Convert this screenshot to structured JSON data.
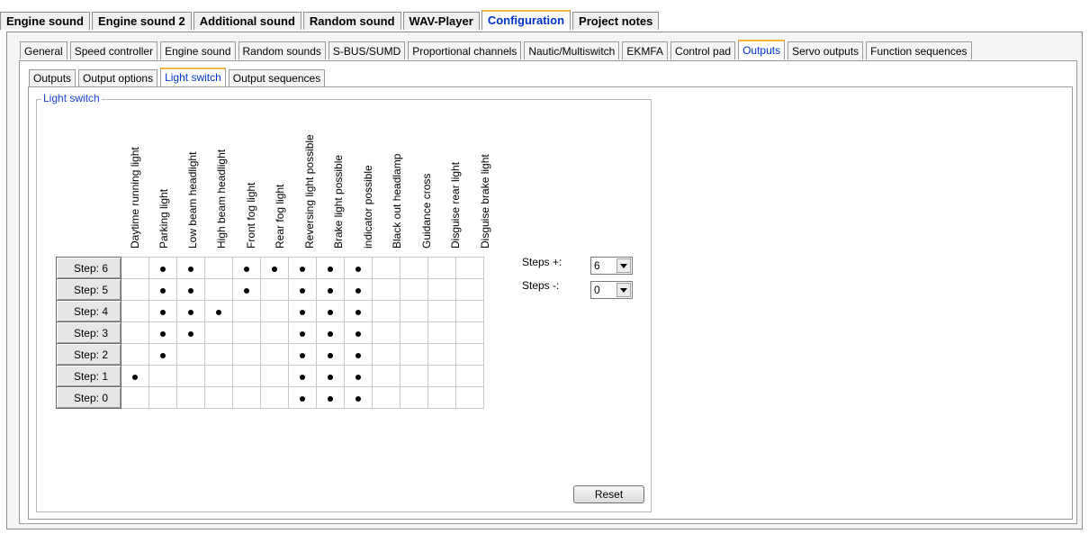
{
  "tabs_level1": [
    "Engine sound",
    "Engine sound 2",
    "Additional sound",
    "Random sound",
    "WAV-Player",
    "Configuration",
    "Project notes"
  ],
  "tabs_level1_active": "Configuration",
  "tabs_level2": [
    "General",
    "Speed controller",
    "Engine sound",
    "Random sounds",
    "S-BUS/SUMD",
    "Proportional channels",
    "Nautic/Multiswitch",
    "EKMFA",
    "Control pad",
    "Outputs",
    "Servo outputs",
    "Function sequences"
  ],
  "tabs_level2_active": "Outputs",
  "tabs_level3": [
    "Outputs",
    "Output options",
    "Light switch",
    "Output sequences"
  ],
  "tabs_level3_active": "Light switch",
  "group_title": "Light switch",
  "columns": [
    "Daytime running light",
    "Parking light",
    "Low beam headlight",
    "High beam headlight",
    "Front fog light",
    "Rear fog light",
    "Reversing light possible",
    "Brake light possible",
    "indicator possible",
    "Black out headlamp",
    "Guidance cross",
    "Disguise rear light",
    "Disguise brake light"
  ],
  "rows": [
    {
      "label": "Step: 6",
      "on": [
        0,
        1,
        1,
        0,
        1,
        1,
        1,
        1,
        1,
        0,
        0,
        0,
        0
      ]
    },
    {
      "label": "Step: 5",
      "on": [
        0,
        1,
        1,
        0,
        1,
        0,
        1,
        1,
        1,
        0,
        0,
        0,
        0
      ]
    },
    {
      "label": "Step: 4",
      "on": [
        0,
        1,
        1,
        1,
        0,
        0,
        1,
        1,
        1,
        0,
        0,
        0,
        0
      ]
    },
    {
      "label": "Step: 3",
      "on": [
        0,
        1,
        1,
        0,
        0,
        0,
        1,
        1,
        1,
        0,
        0,
        0,
        0
      ]
    },
    {
      "label": "Step: 2",
      "on": [
        0,
        1,
        0,
        0,
        0,
        0,
        1,
        1,
        1,
        0,
        0,
        0,
        0
      ]
    },
    {
      "label": "Step: 1",
      "on": [
        1,
        0,
        0,
        0,
        0,
        0,
        1,
        1,
        1,
        0,
        0,
        0,
        0
      ]
    },
    {
      "label": "Step: 0",
      "on": [
        0,
        0,
        0,
        0,
        0,
        0,
        1,
        1,
        1,
        0,
        0,
        0,
        0
      ]
    }
  ],
  "steps_plus": {
    "label": "Steps +:",
    "value": "6"
  },
  "steps_minus": {
    "label": "Steps -:",
    "value": "0"
  },
  "reset_label": "Reset"
}
